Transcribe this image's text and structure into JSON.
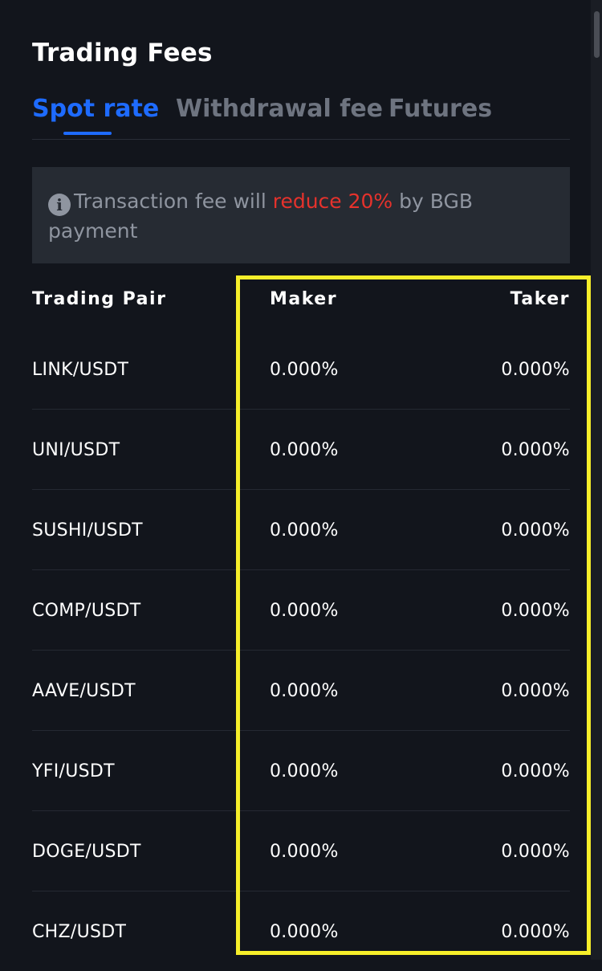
{
  "page": {
    "title": "Trading Fees"
  },
  "tabs": [
    {
      "label": "Spot rate",
      "active": true
    },
    {
      "label": "Withdrawal fee",
      "active": false
    },
    {
      "label": "Futures",
      "active": false
    }
  ],
  "notice": {
    "icon": "info-icon",
    "text_before": "Transaction fee will ",
    "highlight": "reduce 20%",
    "text_after": " by BGB payment"
  },
  "table": {
    "headers": {
      "pair": "Trading Pair",
      "maker": "Maker",
      "taker": "Taker"
    },
    "rows": [
      {
        "pair": "LINK/USDT",
        "maker": "0.000%",
        "taker": "0.000%"
      },
      {
        "pair": "UNI/USDT",
        "maker": "0.000%",
        "taker": "0.000%"
      },
      {
        "pair": "SUSHI/USDT",
        "maker": "0.000%",
        "taker": "0.000%"
      },
      {
        "pair": "COMP/USDT",
        "maker": "0.000%",
        "taker": "0.000%"
      },
      {
        "pair": "AAVE/USDT",
        "maker": "0.000%",
        "taker": "0.000%"
      },
      {
        "pair": "YFI/USDT",
        "maker": "0.000%",
        "taker": "0.000%"
      },
      {
        "pair": "DOGE/USDT",
        "maker": "0.000%",
        "taker": "0.000%"
      },
      {
        "pair": "CHZ/USDT",
        "maker": "0.000%",
        "taker": "0.000%"
      }
    ]
  },
  "colors": {
    "background": "#12151c",
    "accent": "#1e6bff",
    "highlight_text": "#e5322c",
    "annotation_box": "#f6ee2a"
  }
}
